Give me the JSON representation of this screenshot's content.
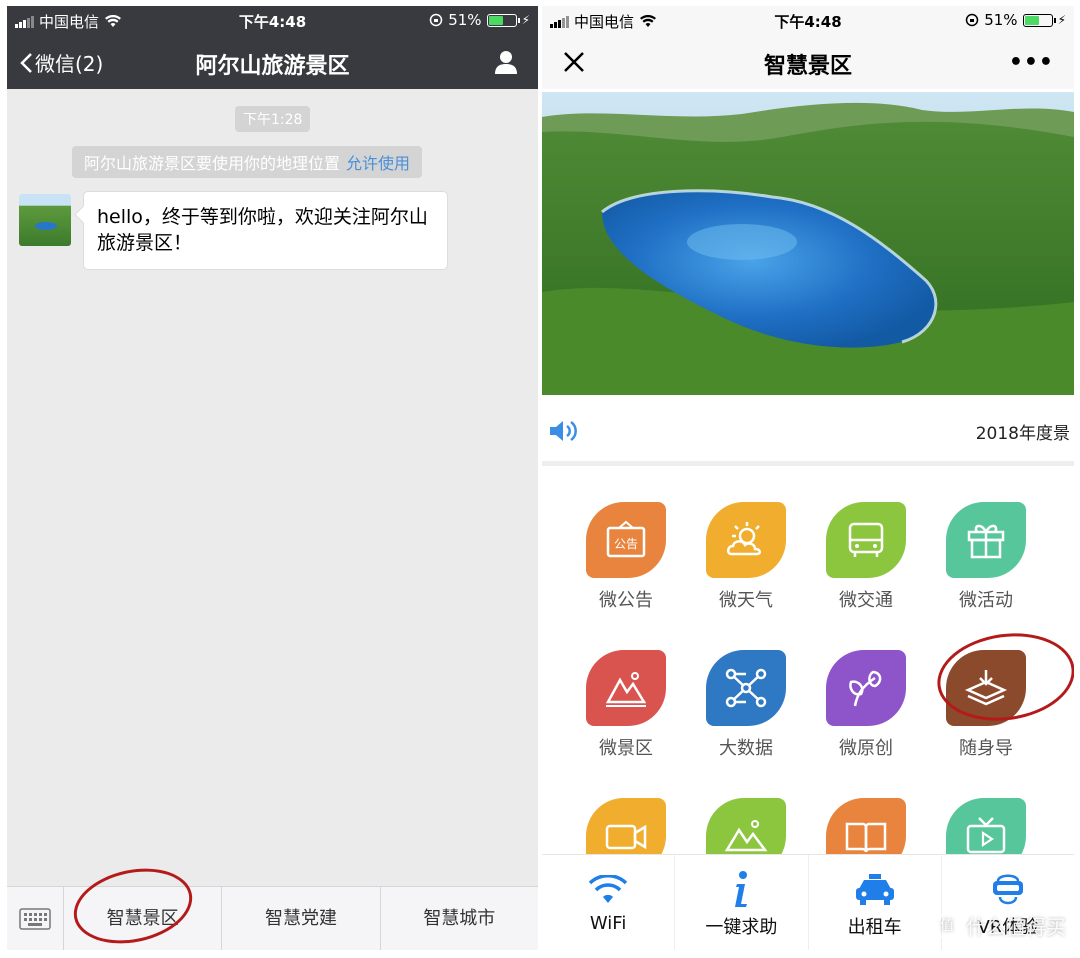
{
  "left_screen": {
    "status_bar": {
      "carrier": "中国电信",
      "time": "下午4:48",
      "battery": "51%"
    },
    "nav": {
      "back_label": "微信(2)",
      "title": "阿尔山旅游景区"
    },
    "chat": {
      "timestamp": "下午1:28",
      "system_message": "阿尔山旅游景区要使用你的地理位置",
      "system_link": "允许使用",
      "message": "hello，终于等到你啦，欢迎关注阿尔山旅游景区！"
    },
    "menu": {
      "items": [
        "智慧景区",
        "智慧党建",
        "智慧城市"
      ]
    }
  },
  "right_screen": {
    "status_bar": {
      "carrier": "中国电信",
      "time": "下午4:48",
      "battery": "51%"
    },
    "nav": {
      "title": "智慧景区",
      "more": "•••"
    },
    "notice": "2018年度景",
    "grid": [
      {
        "label": "微公告",
        "color": "#e8843e",
        "icon": "announcement-icon",
        "badge": "公告"
      },
      {
        "label": "微天气",
        "color": "#f0ad2e",
        "icon": "weather-icon"
      },
      {
        "label": "微交通",
        "color": "#8cc63f",
        "icon": "bus-icon"
      },
      {
        "label": "微活动",
        "color": "#57c69b",
        "icon": "gift-icon"
      },
      {
        "label": "微景区",
        "color": "#d9534f",
        "icon": "mountain-icon"
      },
      {
        "label": "大数据",
        "color": "#2f78c4",
        "icon": "data-network-icon"
      },
      {
        "label": "微原创",
        "color": "#8e54c9",
        "icon": "plant-icon"
      },
      {
        "label": "随身导",
        "color": "#8b4a2b",
        "icon": "download-layers-icon"
      },
      {
        "label": "",
        "color": "#f0ad2e",
        "icon": "video-camera-icon"
      },
      {
        "label": "",
        "color": "#8cc63f",
        "icon": "picture-icon"
      },
      {
        "label": "",
        "color": "#e8843e",
        "icon": "book-icon"
      },
      {
        "label": "",
        "color": "#57c69b",
        "icon": "tv-icon"
      }
    ],
    "bottom_nav": [
      {
        "label": "WiFi",
        "icon": "wifi-icon",
        "color": "#1f7ee8"
      },
      {
        "label": "一键求助",
        "icon": "info-icon",
        "color": "#1f7ee8"
      },
      {
        "label": "出租车",
        "icon": "taxi-icon",
        "color": "#1f7ee8"
      },
      {
        "label": "VR体验",
        "icon": "vr-headset-icon",
        "color": "#1f7ee8"
      }
    ],
    "watermark": "什么值得买",
    "watermark_logo": "值"
  },
  "colors": {
    "wechat_bar": "#393a3f",
    "link": "#4a90d9",
    "annotation_red": "#b51a1a"
  }
}
